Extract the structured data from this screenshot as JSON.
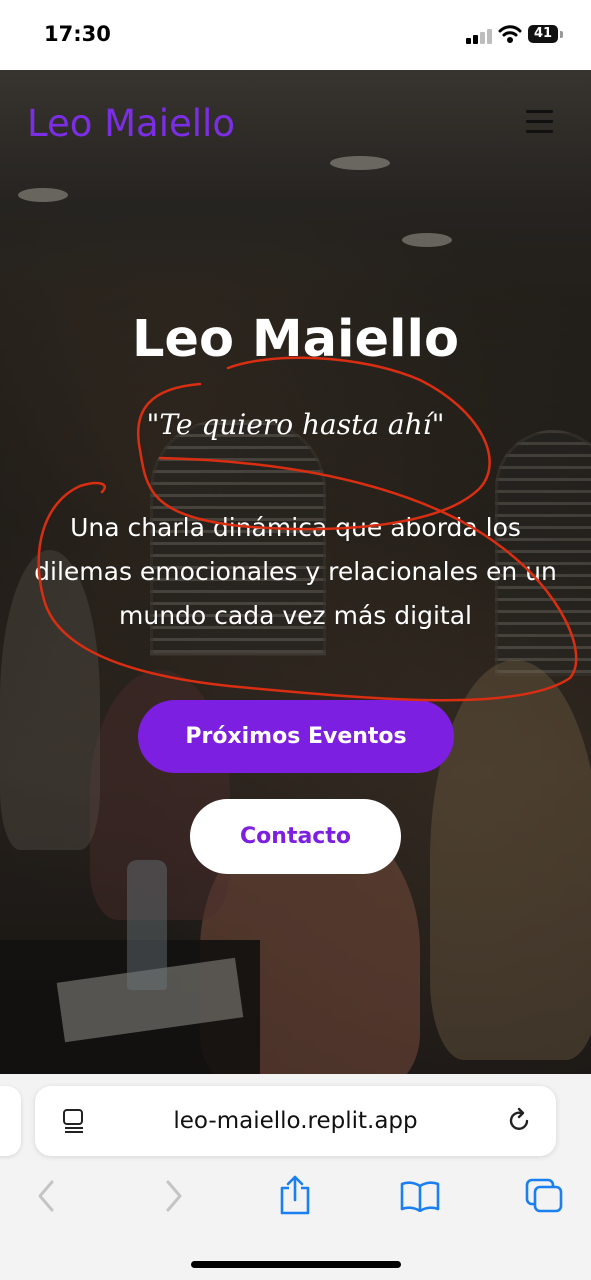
{
  "status_bar": {
    "time": "17:30",
    "battery": "41"
  },
  "site": {
    "brand": "Leo Maiello",
    "hero": {
      "title": "Leo Maiello",
      "quote": "\"Te quiero hasta ahí\"",
      "description": "Una charla dinámica que aborda los dilemas emocionales y relacionales en un mundo cada vez más digital"
    },
    "buttons": {
      "events": "Próximos Eventos",
      "contact": "Contacto"
    }
  },
  "browser": {
    "url": "leo-maiello.replit.app"
  },
  "colors": {
    "accent": "#7d1fe0",
    "brand": "#7c2ee6",
    "annotation": "#d92e12",
    "safari_blue": "#1a7ff0"
  },
  "icons": [
    "signal-icon",
    "wifi-icon",
    "battery-icon",
    "menu-icon",
    "reader-icon",
    "reload-icon",
    "back-icon",
    "forward-icon",
    "share-icon",
    "bookmarks-icon",
    "tabs-icon"
  ]
}
